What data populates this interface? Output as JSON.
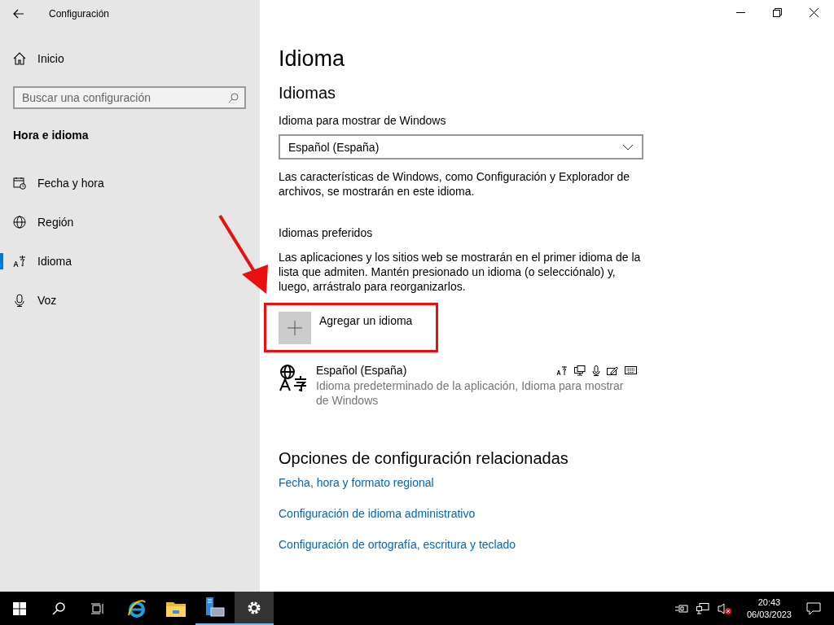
{
  "window": {
    "title": "Configuración"
  },
  "sidebar": {
    "home": "Inicio",
    "search": {
      "placeholder": "Buscar una configuración"
    },
    "section_title": "Hora e idioma",
    "items": [
      {
        "kind": "calendar",
        "label": "Fecha y hora",
        "selected": false
      },
      {
        "kind": "globe",
        "label": "Región",
        "selected": false
      },
      {
        "kind": "language",
        "label": "Idioma",
        "selected": true
      },
      {
        "kind": "microphone",
        "label": "Voz",
        "selected": false
      }
    ]
  },
  "main": {
    "title": "Idioma",
    "section_title": "Idiomas",
    "display_language": {
      "label": "Idioma para mostrar de Windows",
      "value": "Español (España)",
      "description": "Las características de Windows, como Configuración y Explorador de archivos, se mostrarán en este idioma."
    },
    "preferred": {
      "title": "Idiomas preferidos",
      "description": "Las aplicaciones y los sitios web se mostrarán en el primer idioma de la lista que admiten. Mantén presionado un idioma (o selecciónalo) y, luego, arrástralo para reorganizarlos.",
      "add_button": "Agregar un idioma",
      "languages": [
        {
          "name": "Español (España)",
          "description": "Idioma predeterminado de la aplicación, Idioma para mostrar de Windows"
        }
      ]
    },
    "related": {
      "title": "Opciones de configuración relacionadas",
      "links": [
        "Fecha, hora y formato regional",
        "Configuración de idioma administrativo",
        "Configuración de ortografía, escritura y teclado"
      ]
    }
  },
  "taskbar": {
    "apps": [
      {
        "kind": "browser",
        "running": false,
        "selected": false
      },
      {
        "kind": "folder",
        "running": false,
        "selected": false
      },
      {
        "kind": "server",
        "running": true,
        "selected": false
      },
      {
        "kind": "settings",
        "running": true,
        "selected": true
      }
    ],
    "time": "20:43",
    "date": "06/03/2023"
  }
}
